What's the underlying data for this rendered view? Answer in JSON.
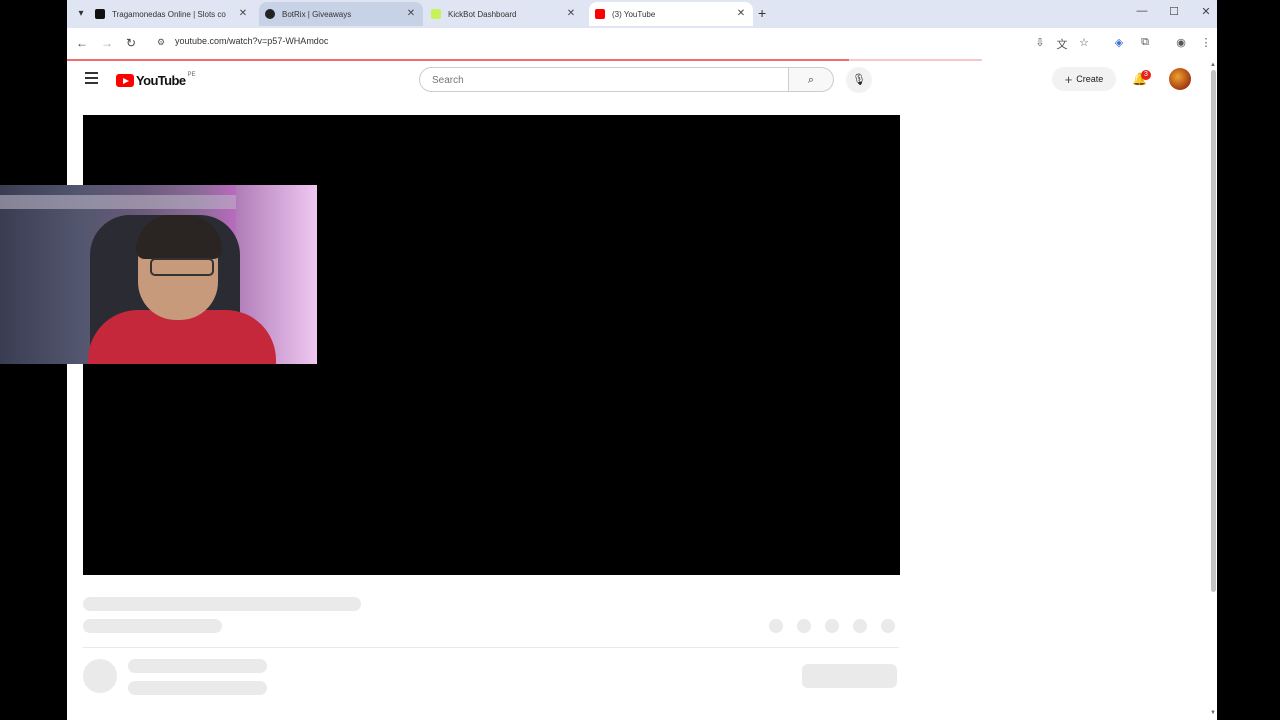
{
  "browser": {
    "tabs": [
      {
        "title": "Tragamonedas Online | Slots co",
        "favicon_color": "#111111",
        "state": "normal"
      },
      {
        "title": "BotRix | Giveaways",
        "favicon_color": "#222222",
        "state": "hover"
      },
      {
        "title": "KickBot Dashboard",
        "favicon_color": "#c6f25a",
        "state": "normal"
      },
      {
        "title": "(3) YouTube",
        "favicon_color": "#ff0000",
        "state": "active"
      }
    ],
    "tab_list_icon": "▾",
    "close_glyph": "✕",
    "new_tab": "+",
    "window_controls": {
      "minimize": "—",
      "maximize": "☐",
      "close": "✕"
    },
    "toolbar": {
      "back": "←",
      "forward": "→",
      "reload": "↻",
      "site_info": "⚙",
      "url": "youtube.com/watch?v=p57-WHAmdoc",
      "install": "⇩",
      "translate": "文",
      "star": "☆",
      "extensions": "⧉",
      "shield": "◈",
      "profile": "◉",
      "more": "⋮"
    },
    "load_progress": 0.855
  },
  "youtube": {
    "logo_text": "YouTube",
    "country_code": "PE",
    "search_placeholder": "Search",
    "search_icon": "⌕",
    "mic_icon": "🎙",
    "create_label": "Create",
    "create_icon": "+",
    "bell_icon": "🔔",
    "notification_count": "3"
  }
}
